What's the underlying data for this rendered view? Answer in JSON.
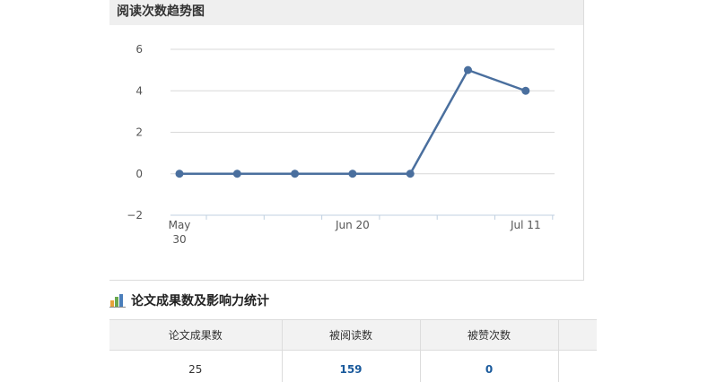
{
  "chart_panel": {
    "title": "阅读次数趋势图"
  },
  "chart_data": {
    "type": "line",
    "title": "阅读次数趋势图",
    "xlabel": "",
    "ylabel": "",
    "x_tick_labels": [
      "May 30",
      "Jun 20",
      "Jul 11"
    ],
    "x_points": [
      "May 30",
      "Jun 6",
      "Jun 13",
      "Jun 20",
      "Jun 27",
      "Jul 4",
      "Jul 11"
    ],
    "y_ticks": [
      "−2",
      "0",
      "2",
      "4",
      "6"
    ],
    "ylim": [
      -2,
      6
    ],
    "grid": true,
    "series": [
      {
        "values": [
          0,
          0,
          0,
          0,
          0,
          5,
          4
        ]
      }
    ],
    "colors": {
      "line": "#4a6f9e",
      "grid": "#d8d8d8",
      "axis": "#c0d0e0"
    }
  },
  "stats": {
    "title": "论文成果数及影响力统计",
    "headers": [
      "论文成果数",
      "被阅读数",
      "被赞次数",
      ""
    ],
    "values": [
      "25",
      "159",
      "0",
      ""
    ]
  }
}
